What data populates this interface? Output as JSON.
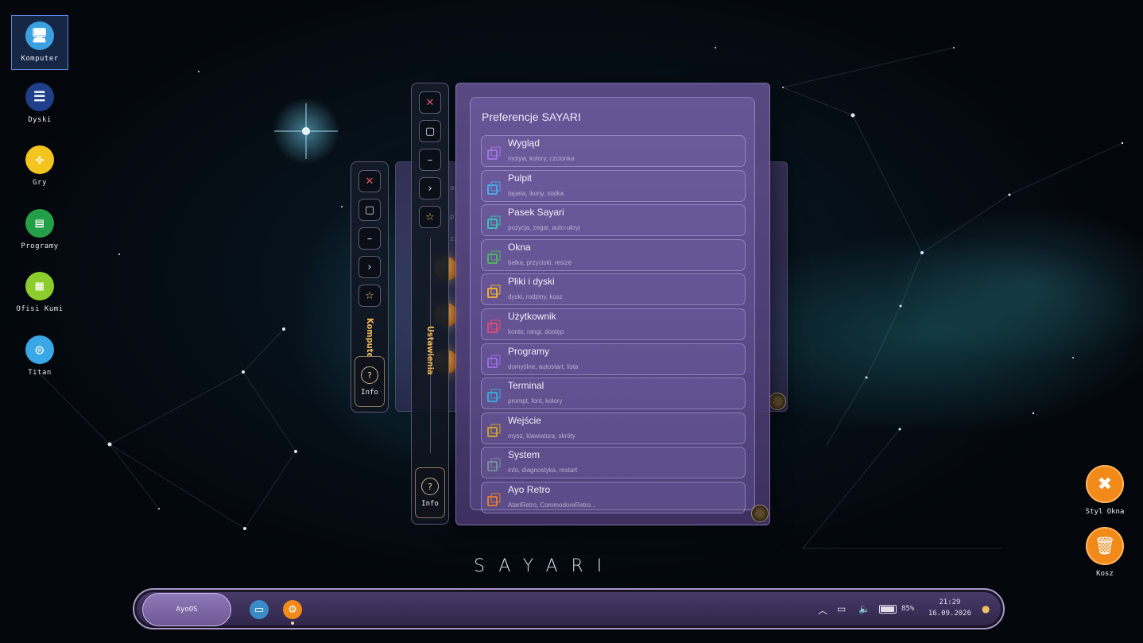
{
  "desktop_icons": [
    {
      "label": "Komputer",
      "icon": "computer-icon",
      "color": "#3aa0e0",
      "glyph": "🖥"
    },
    {
      "label": "Dyski",
      "icon": "disks-icon",
      "color": "#1f3f8a",
      "glyph": "☰"
    },
    {
      "label": "Gry",
      "icon": "gamepad-icon",
      "color": "#f3c51e",
      "glyph": "✜"
    },
    {
      "label": "Programy",
      "icon": "programs-icon",
      "color": "#23a047",
      "glyph": "▤"
    },
    {
      "label": "Ofisi Kumi",
      "icon": "office-icon",
      "color": "#8ccc2c",
      "glyph": "▦"
    },
    {
      "label": "Titan",
      "icon": "globe-icon",
      "color": "#39a7e8",
      "glyph": "◎"
    }
  ],
  "right_apps": [
    {
      "label": "Styl Okna",
      "icon": "tools-icon"
    },
    {
      "label": "Kosz",
      "icon": "trash-icon"
    }
  ],
  "window_back": {
    "vertical_title": "Komputer",
    "info_label": "Info",
    "faded_text": [
      "ac",
      "pl",
      "zi"
    ]
  },
  "window_front": {
    "vertical_title": "Ustawienia",
    "info_label": "Info"
  },
  "preferences": {
    "title": "Preferencje SAYARI",
    "items": [
      {
        "name": "Wygląd",
        "desc": "motyw, kolory, czcionka",
        "color": "#a274e0"
      },
      {
        "name": "Pulpit",
        "desc": "tapeta, ikony, siatka",
        "color": "#4aa8e8"
      },
      {
        "name": "Pasek Sayari",
        "desc": "pozycja, zegar, auto-ukryj",
        "color": "#3cc0b0"
      },
      {
        "name": "Okna",
        "desc": "belka, przyciski, resize",
        "color": "#54b060"
      },
      {
        "name": "Pliki i dyski",
        "desc": "dyski, rodziny, kosz",
        "color": "#e8b030"
      },
      {
        "name": "Użytkownik",
        "desc": "konto, rangi, dostęp",
        "color": "#e04a78"
      },
      {
        "name": "Programy",
        "desc": "domyślne, autostart, lista",
        "color": "#9a6ce0"
      },
      {
        "name": "Terminal",
        "desc": "prompt, font, kolory",
        "color": "#3aa8d8"
      },
      {
        "name": "Wejście",
        "desc": "mysz, klawiatura, skróty",
        "color": "#c8a030"
      },
      {
        "name": "System",
        "desc": "info, diagnostyka, restart",
        "color": "#7a8ca0"
      },
      {
        "name": "Ayo Retro",
        "desc": "AtariRetro, CommodoreRetro...",
        "color": "#e07a30"
      }
    ]
  },
  "brand": "SAYARI",
  "taskbar": {
    "start_label": "AyoOS",
    "battery": "85%",
    "time": "21:29",
    "date": "16.09.2026"
  }
}
